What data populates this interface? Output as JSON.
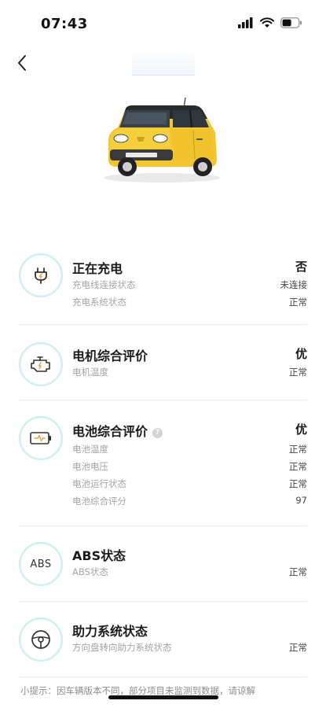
{
  "status_bar": {
    "time": "07:43"
  },
  "nav": {
    "back_icon": "chevron-left-icon",
    "title": ""
  },
  "items": [
    {
      "icon": "charging-plug-icon",
      "title": "正在充电",
      "value": "否",
      "rows": [
        {
          "label": "充电线连接状态",
          "value": "未连接"
        },
        {
          "label": "充电系统状态",
          "value": "正常"
        }
      ]
    },
    {
      "icon": "motor-engine-icon",
      "title": "电机综合评价",
      "value": "优",
      "rows": [
        {
          "label": "电机温度",
          "value": "正常"
        }
      ]
    },
    {
      "icon": "battery-icon",
      "title": "电池综合评价",
      "help_icon": "question-icon",
      "help_text": "?",
      "value": "优",
      "rows": [
        {
          "label": "电池温度",
          "value": "正常"
        },
        {
          "label": "电池电压",
          "value": "正常"
        },
        {
          "label": "电池运行状态",
          "value": "正常"
        },
        {
          "label": "电池综合评分",
          "value": "97"
        }
      ]
    },
    {
      "icon": "abs-icon",
      "icon_text": "ABS",
      "title": "ABS状态",
      "value": "",
      "rows": [
        {
          "label": "ABS状态",
          "value": "正常"
        }
      ]
    },
    {
      "icon": "steering-wheel-icon",
      "title": "助力系统状态",
      "value": "",
      "rows": [
        {
          "label": "方向盘转向助力系统状态",
          "value": "正常"
        }
      ]
    }
  ],
  "tip": "小提示：因车辆版本不同，部分项目未监测到数据，请谅解",
  "colors": {
    "icon_ring": "#cdeef2",
    "divider": "#ececec",
    "car_body": "#f2c531"
  }
}
